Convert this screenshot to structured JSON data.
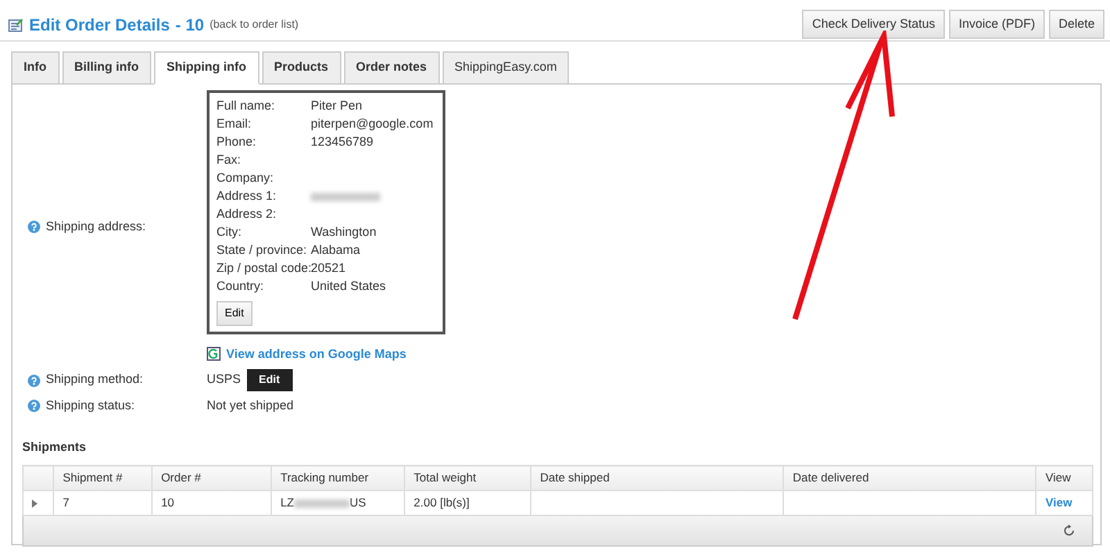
{
  "header": {
    "title": "Edit Order Details",
    "order_number": "- 10",
    "back_link": "(back to order list)"
  },
  "actions": [
    "Check Delivery Status",
    "Invoice (PDF)",
    "Delete"
  ],
  "tabs": [
    {
      "label": "Info",
      "selected": false
    },
    {
      "label": "Billing info",
      "selected": false
    },
    {
      "label": "Shipping info",
      "selected": true
    },
    {
      "label": "Products",
      "selected": false
    },
    {
      "label": "Order notes",
      "selected": false
    },
    {
      "label": "ShippingEasy.com",
      "selected": false
    }
  ],
  "shipping_address": {
    "label": "Shipping address:",
    "fields": [
      {
        "label": "Full name:",
        "value": "Piter Pen"
      },
      {
        "label": "Email:",
        "value": "piterpen@google.com"
      },
      {
        "label": "Phone:",
        "value": "123456789"
      },
      {
        "label": "Fax:"
      },
      {
        "label": "Company:"
      },
      {
        "label": "Address 1:",
        "blurred": true
      },
      {
        "label": "Address 2:"
      },
      {
        "label": "City:",
        "value": "Washington"
      },
      {
        "label": "State / province:",
        "value": "Alabama"
      },
      {
        "label": "Zip / postal code:",
        "value": "20521"
      },
      {
        "label": "Country:",
        "value": "United States"
      }
    ],
    "edit_button": "Edit",
    "maps_link": "View address on Google Maps"
  },
  "shipping_method": {
    "label": "Shipping method:",
    "value": "USPS",
    "edit_button": "Edit"
  },
  "shipping_status": {
    "label": "Shipping status:",
    "value": "Not yet shipped"
  },
  "shipments": {
    "title": "Shipments",
    "columns": [
      "Shipment #",
      "Order #",
      "Tracking number",
      "Total weight",
      "Date shipped",
      "Date delivered",
      "View"
    ],
    "rows": [
      {
        "shipment": "7",
        "order": "10",
        "tracking_prefix": "LZ",
        "tracking_suffix": "US",
        "weight": "2.00 [lb(s)]",
        "date_shipped": "",
        "date_delivered": "",
        "view": "View"
      }
    ]
  }
}
